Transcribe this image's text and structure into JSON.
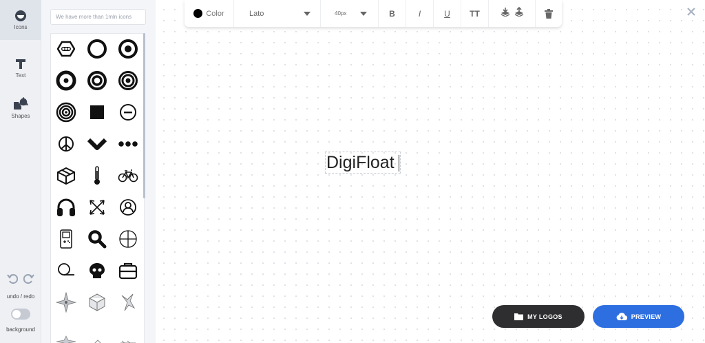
{
  "rail": {
    "items": [
      {
        "label": "Icons",
        "icon": "icons-icon",
        "active": true
      },
      {
        "label": "Text",
        "icon": "text-icon",
        "active": false
      },
      {
        "label": "Shapes",
        "icon": "shapes-icon",
        "active": false
      }
    ],
    "undo_redo_label": "undo / redo",
    "background_label": "background"
  },
  "icon_panel": {
    "search_placeholder": "We have more than 1mln icons",
    "icons": [
      "hexagon-dots-icon",
      "ring-icon",
      "bullseye-icon",
      "target-dot-icon",
      "double-ring-icon",
      "triple-ring-icon",
      "concentric-target-icon",
      "square-icon",
      "minus-circle-icon",
      "peace-sign-icon",
      "chevron-down-icon",
      "three-dots-icon",
      "box-icon",
      "thermometer-icon",
      "bicycle-icon",
      "headphones-icon",
      "crossed-arrows-icon",
      "user-circle-icon",
      "gameboy-icon",
      "magnifier-icon",
      "four-petal-icon",
      "speech-circle-icon",
      "skull-icon",
      "briefcase-icon",
      "compass-star-icon",
      "isometric-cube-icon",
      "origami-bird-icon"
    ]
  },
  "toolbar": {
    "color_label": "Color",
    "color_value": "#000000",
    "font_name": "Lato",
    "font_size": "40px",
    "bold": "B",
    "italic": "I",
    "underline": "U",
    "uppercase": "TT"
  },
  "canvas": {
    "text": "DigiFloat"
  },
  "buttons": {
    "my_logos": "MY LOGOS",
    "preview": "PREVIEW"
  },
  "colors": {
    "accent": "#2d6fe0",
    "dark_button": "#2e2e30",
    "rail_bg": "#eef0f4",
    "icon_color": "#111111"
  }
}
